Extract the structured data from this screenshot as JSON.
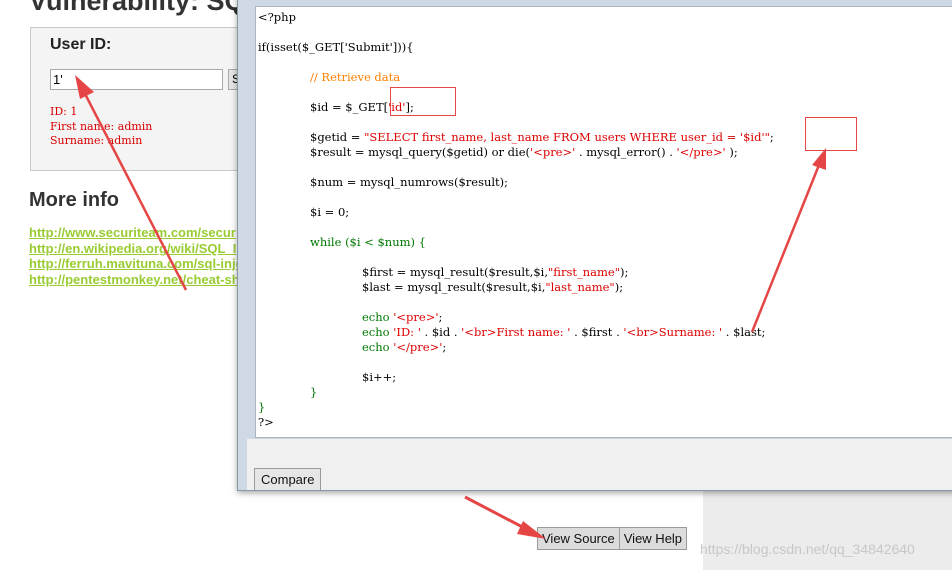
{
  "page": {
    "title": "Vulnerability: SQ",
    "form_label": "User ID:",
    "userid_value": "1'",
    "submit_stub": "S",
    "result": {
      "id_line": "ID: 1",
      "first_line": "First name: admin",
      "surname_line": "Surname: admin"
    },
    "more_info_title": "More info",
    "links": [
      "http://www.securiteam.com/secur",
      "http://en.wikipedia.org/wiki/SQL_I",
      "http://ferruh.mavituna.com/sql-inje",
      "http://pentestmonkey.net/cheat-she"
    ],
    "view_source_label": "View Source",
    "view_help_label": "View Help",
    "watermark": "https://blog.csdn.net/qq_34842640"
  },
  "popup": {
    "compare_label": "Compare",
    "code": {
      "l1": "<?php",
      "l2": "if(isset($_GET['Submit'])){",
      "l3": "// Retrieve data",
      "l4a": "$id = $_GET[",
      "l4b": "'id'",
      "l4c": "];",
      "l5a": "$getid = ",
      "l5b": "\"SELECT first_name, last_name FROM users WHERE user_id = '$id'\"",
      "l5c": ";",
      "l6a": "$result = mysql_query($getid) or die(",
      "l6b": "'<pre>'",
      "l6c": " . mysql_error() . ",
      "l6d": "'</pre>'",
      "l6e": " );",
      "l7": "$num = mysql_numrows($result);",
      "l8": "$i = 0;",
      "l9": "while ($i < $num) {",
      "l10a": "$first = mysql_result($result,$i,",
      "l10b": "\"first_name\"",
      "l10c": ");",
      "l11a": "$last = mysql_result($result,$i,",
      "l11b": "\"last_name\"",
      "l11c": ");",
      "l12a": "echo ",
      "l12b": "'<pre>'",
      "l12c": ";",
      "l13a": "echo ",
      "l13b": "'ID: '",
      "l13c": " . $id . ",
      "l13d": "'<br>First name: '",
      "l13e": " . $first . ",
      "l13f": "'<br>Surname: '",
      "l13g": " . $last;",
      "l14a": "echo ",
      "l14b": "'</pre>'",
      "l14c": ";",
      "l15": "$i++;",
      "l16": "}",
      "l17": "}",
      "l18": "?>"
    }
  },
  "colors": {
    "code_keyword": "#007700",
    "code_string": "#dd0000",
    "code_comment": "#ff8000",
    "link_green": "#99cc33",
    "annotation_red": "#e54545"
  },
  "icons": [
    "red-annotation-arrow",
    "red-highlight-box"
  ]
}
